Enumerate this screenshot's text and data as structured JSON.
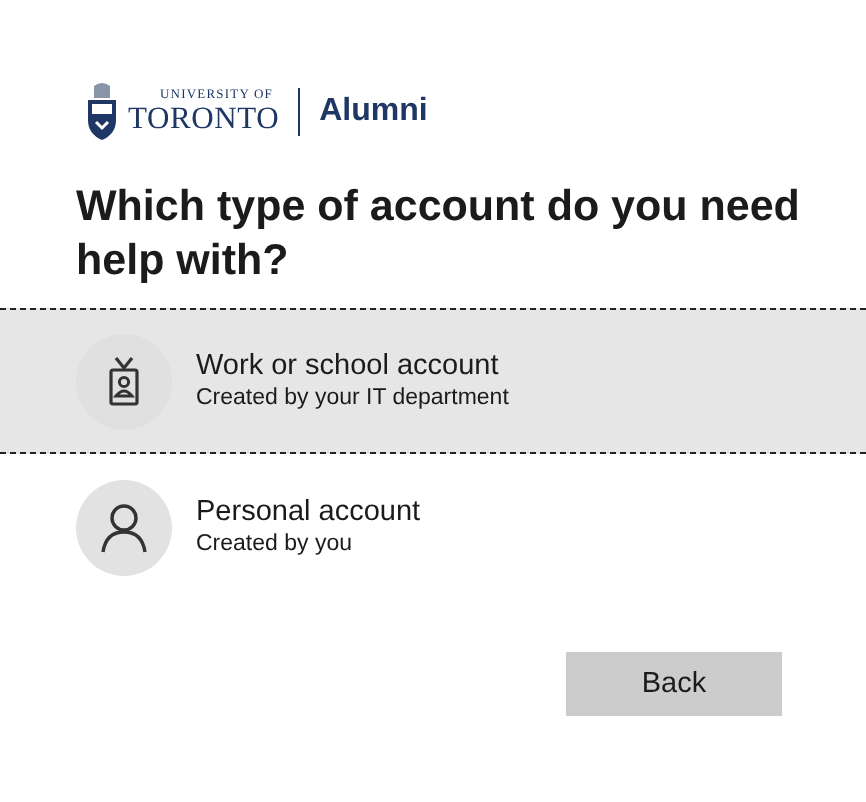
{
  "logo": {
    "line_1": "UNIVERSITY OF",
    "line_2": "TORONTO",
    "label": "Alumni"
  },
  "heading": "Which type of account do you need help with?",
  "options": [
    {
      "kind": "work",
      "title": "Work or school account",
      "subtitle": "Created by your IT department",
      "selected": true
    },
    {
      "kind": "personal",
      "title": "Personal account",
      "subtitle": "Created by you",
      "selected": false
    }
  ],
  "buttons": [
    "Back"
  ]
}
